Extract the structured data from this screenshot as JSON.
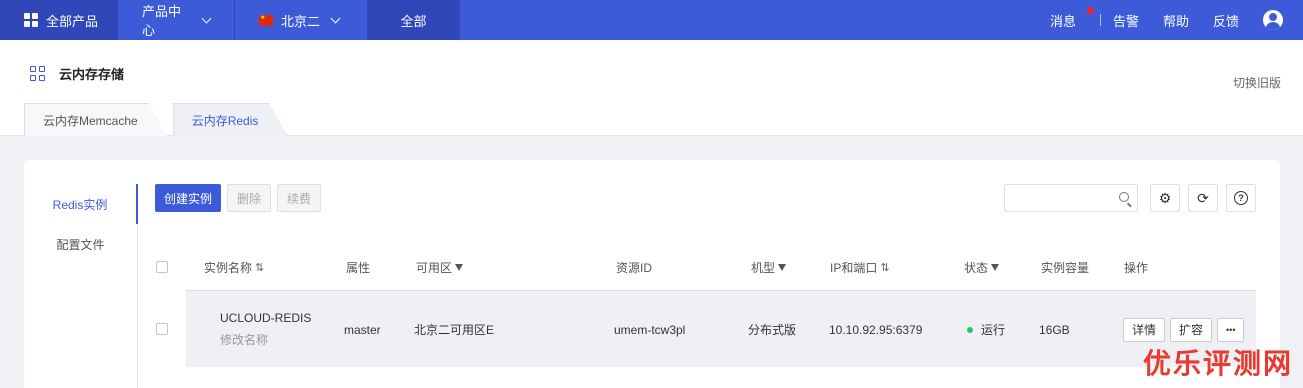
{
  "topnav": {
    "all_products": "全部产品",
    "product_center": "产品中心",
    "region": "北京二",
    "all_tab": "全部",
    "messages": "消息",
    "alerts": "告警",
    "help": "帮助",
    "feedback": "反馈"
  },
  "header": {
    "title": "云内存存储",
    "switch_old": "切换旧版",
    "tabs": [
      "云内存Memcache",
      "云内存Redis"
    ]
  },
  "sidebar": {
    "items": [
      "Redis实例",
      "配置文件"
    ]
  },
  "toolbar": {
    "create": "创建实例",
    "delete": "删除",
    "renew": "续费",
    "search_placeholder": ""
  },
  "table": {
    "headers": [
      "实例名称",
      "属性",
      "可用区",
      "资源ID",
      "机型",
      "IP和端口",
      "状态",
      "实例容量",
      "操作"
    ],
    "rows": [
      {
        "name": "UCLOUD-REDIS",
        "rename": "修改名称",
        "attr": "master",
        "zone": "北京二可用区E",
        "resource_id": "umem-tcw3pl",
        "type": "分布式版",
        "ip_port": "10.10.92.95:6379",
        "status": "运行",
        "capacity": "16GB",
        "ops": [
          "详情",
          "扩容",
          "•••"
        ]
      }
    ]
  },
  "watermark": "优乐评测网",
  "colors": {
    "brand": "#3d5bd9",
    "running": "#2ec26a"
  }
}
